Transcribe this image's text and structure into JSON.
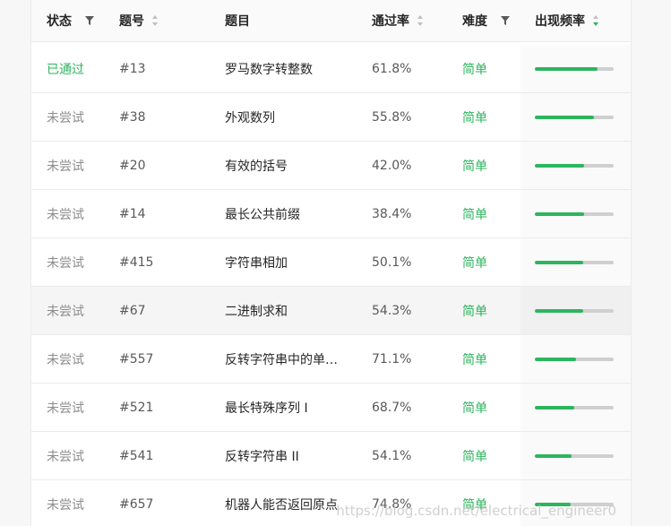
{
  "columns": {
    "status": "状态",
    "id": "题号",
    "title": "题目",
    "rate": "通过率",
    "difficulty": "难度",
    "frequency": "出现频率"
  },
  "rows": [
    {
      "status": "已通过",
      "status_kind": "passed",
      "id": "#13",
      "title": "罗马数字转整数",
      "rate": "61.8%",
      "difficulty": "简单",
      "frequency": 0.8
    },
    {
      "status": "未尝试",
      "status_kind": "untried",
      "id": "#38",
      "title": "外观数列",
      "rate": "55.8%",
      "difficulty": "简单",
      "frequency": 0.75
    },
    {
      "status": "未尝试",
      "status_kind": "untried",
      "id": "#20",
      "title": "有效的括号",
      "rate": "42.0%",
      "difficulty": "简单",
      "frequency": 0.63
    },
    {
      "status": "未尝试",
      "status_kind": "untried",
      "id": "#14",
      "title": "最长公共前缀",
      "rate": "38.4%",
      "difficulty": "简单",
      "frequency": 0.63
    },
    {
      "status": "未尝试",
      "status_kind": "untried",
      "id": "#415",
      "title": "字符串相加",
      "rate": "50.1%",
      "difficulty": "简单",
      "frequency": 0.61
    },
    {
      "status": "未尝试",
      "status_kind": "untried",
      "id": "#67",
      "title": "二进制求和",
      "rate": "54.3%",
      "difficulty": "简单",
      "frequency": 0.61
    },
    {
      "status": "未尝试",
      "status_kind": "untried",
      "id": "#557",
      "title": "反转字符串中的单…",
      "rate": "71.1%",
      "difficulty": "简单",
      "frequency": 0.52
    },
    {
      "status": "未尝试",
      "status_kind": "untried",
      "id": "#521",
      "title": "最长特殊序列 Ⅰ",
      "rate": "68.7%",
      "difficulty": "简单",
      "frequency": 0.5
    },
    {
      "status": "未尝试",
      "status_kind": "untried",
      "id": "#541",
      "title": "反转字符串 II",
      "rate": "54.1%",
      "difficulty": "简单",
      "frequency": 0.47
    },
    {
      "status": "未尝试",
      "status_kind": "untried",
      "id": "#657",
      "title": "机器人能否返回原点",
      "rate": "74.8%",
      "difficulty": "简单",
      "frequency": 0.45
    }
  ],
  "highlighted_row": 5,
  "colors": {
    "passed": "#2db55d",
    "easy": "#2db55d",
    "bar_fill": "#2db55d",
    "bar_track": "#cfcfcf"
  },
  "watermark": "https://blog.csdn.net/electrical_engineer0"
}
